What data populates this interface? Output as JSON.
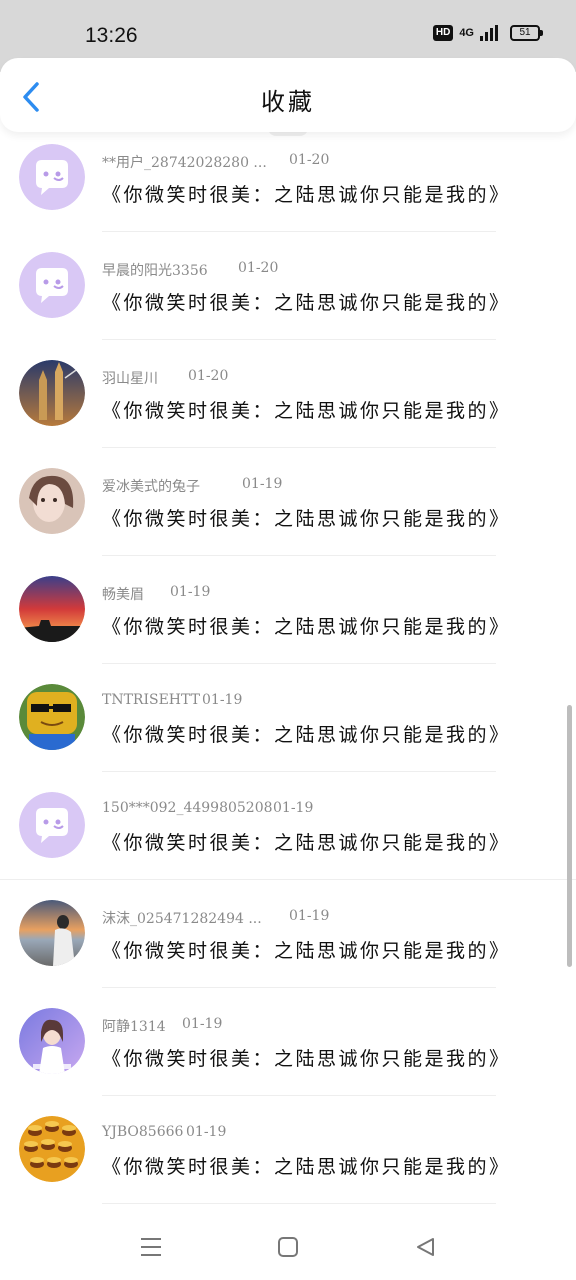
{
  "status": {
    "time": "13:26",
    "hd": "HD",
    "network": "4G",
    "battery": "51"
  },
  "header": {
    "title": "收藏"
  },
  "rows": [
    {
      "user": "**用户_28742028280 ...",
      "date": "01-20",
      "title": "《你微笑时很美：之陆思诚你只能是我的》",
      "avatar": "default-chat-avatar"
    },
    {
      "user": "早晨的阳光3356",
      "date": "01-20",
      "title": "《你微笑时很美：之陆思诚你只能是我的》",
      "avatar": "default-chat-avatar"
    },
    {
      "user": "羽山星川",
      "date": "01-20",
      "title": "《你微笑时很美：之陆思诚你只能是我的》",
      "avatar": "photo-castle-avatar"
    },
    {
      "user": "爱冰美式的兔子",
      "date": "01-19",
      "title": "《你微笑时很美：之陆思诚你只能是我的》",
      "avatar": "photo-girl-avatar"
    },
    {
      "user": "畅美眉",
      "date": "01-19",
      "title": "《你微笑时很美：之陆思诚你只能是我的》",
      "avatar": "photo-sunset-avatar"
    },
    {
      "user": "TNTRISEHTT",
      "date": "01-19",
      "title": "《你微笑时很美：之陆思诚你只能是我的》",
      "avatar": "cartoon-sunglasses-avatar"
    },
    {
      "user": "150***092_4499805208",
      "date": "01-19",
      "title": "《你微笑时很美：之陆思诚你只能是我的》",
      "avatar": "default-chat-avatar"
    },
    {
      "user": "沫沫_025471282494 ...",
      "date": "01-19",
      "title": "《你微笑时很美：之陆思诚你只能是我的》",
      "avatar": "photo-beach-avatar"
    },
    {
      "user": "阿静1314",
      "date": "01-19",
      "title": "《你微笑时很美：之陆思诚你只能是我的》",
      "avatar": "photo-singer-avatar"
    },
    {
      "user": "YJBO85666",
      "date": "01-19",
      "title": "《你微笑时很美：之陆思诚你只能是我的》",
      "avatar": "burger-pattern-avatar"
    }
  ],
  "colors": {
    "accent": "#2d8cf0",
    "default_avatar": "#d9c8f5"
  }
}
